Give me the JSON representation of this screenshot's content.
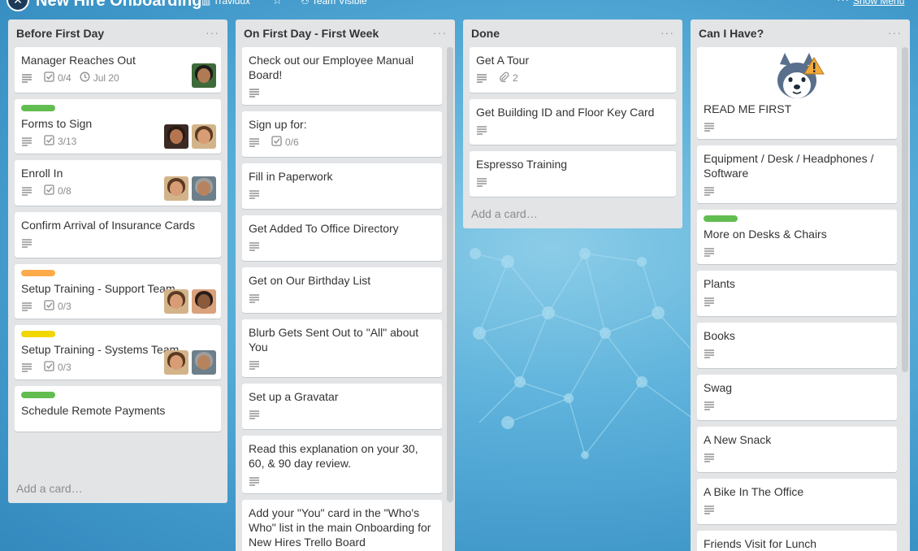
{
  "header": {
    "board_title": "New Hire Onboarding",
    "org": "Travidux",
    "visibility": "Team Visible",
    "show_menu": "Show Menu"
  },
  "lists": [
    {
      "title": "Before First Day",
      "add_card": "Add a card…",
      "cards": [
        {
          "title": "Manager Reaches Out",
          "checklist": "0/4",
          "due": "Jul 20",
          "avatars": [
            "man"
          ]
        },
        {
          "title": "Forms to Sign",
          "label_color": "#61bd4f",
          "checklist": "3/13",
          "avatars": [
            "woman-dark",
            "woman"
          ]
        },
        {
          "title": "Enroll In",
          "checklist": "0/8",
          "avatars": [
            "woman",
            "man-gray"
          ]
        },
        {
          "title": "Confirm Arrival of Insurance Cards"
        },
        {
          "title": "Setup Training - Support Team",
          "label_color": "#ffab4a",
          "checklist": "0/3",
          "avatars": [
            "woman",
            "woman-glasses"
          ]
        },
        {
          "title": "Setup Training - Systems Team",
          "label_color": "#f2d600",
          "checklist": "0/3",
          "avatars": [
            "woman",
            "man-gray"
          ]
        },
        {
          "title": "Schedule Remote Payments",
          "label_color": "#61bd4f",
          "no_desc": true
        }
      ]
    },
    {
      "title": "On First Day - First Week",
      "cards": [
        {
          "title": "Check out our Employee Manual Board!"
        },
        {
          "title": "Sign up for:",
          "checklist": "0/6"
        },
        {
          "title": "Fill in Paperwork"
        },
        {
          "title": "Get Added To Office Directory"
        },
        {
          "title": "Get on Our Birthday List"
        },
        {
          "title": "Blurb Gets Sent Out to \"All\" about You"
        },
        {
          "title": "Set up a Gravatar"
        },
        {
          "title": "Read this explanation on your 30, 60, & 90 day review."
        },
        {
          "title": "Add your \"You\" card in the \"Who's Who\" list in the main Onboarding for New Hires Trello Board",
          "no_desc": true
        }
      ]
    },
    {
      "title": "Done",
      "add_card": "Add a card…",
      "cards": [
        {
          "title": "Get A Tour",
          "attachments": "2"
        },
        {
          "title": "Get Building ID and Floor Key Card"
        },
        {
          "title": "Espresso Training"
        }
      ]
    },
    {
      "title": "Can I Have?",
      "cards": [
        {
          "title": "READ ME FIRST",
          "cover": "husky"
        },
        {
          "title": "Equipment / Desk / Headphones / Software"
        },
        {
          "title": "More on Desks & Chairs",
          "label_color": "#61bd4f"
        },
        {
          "title": "Plants"
        },
        {
          "title": "Books"
        },
        {
          "title": "Swag"
        },
        {
          "title": "A New Snack"
        },
        {
          "title": "A Bike In The Office"
        },
        {
          "title": "Friends Visit for Lunch",
          "no_desc": true
        }
      ]
    }
  ]
}
